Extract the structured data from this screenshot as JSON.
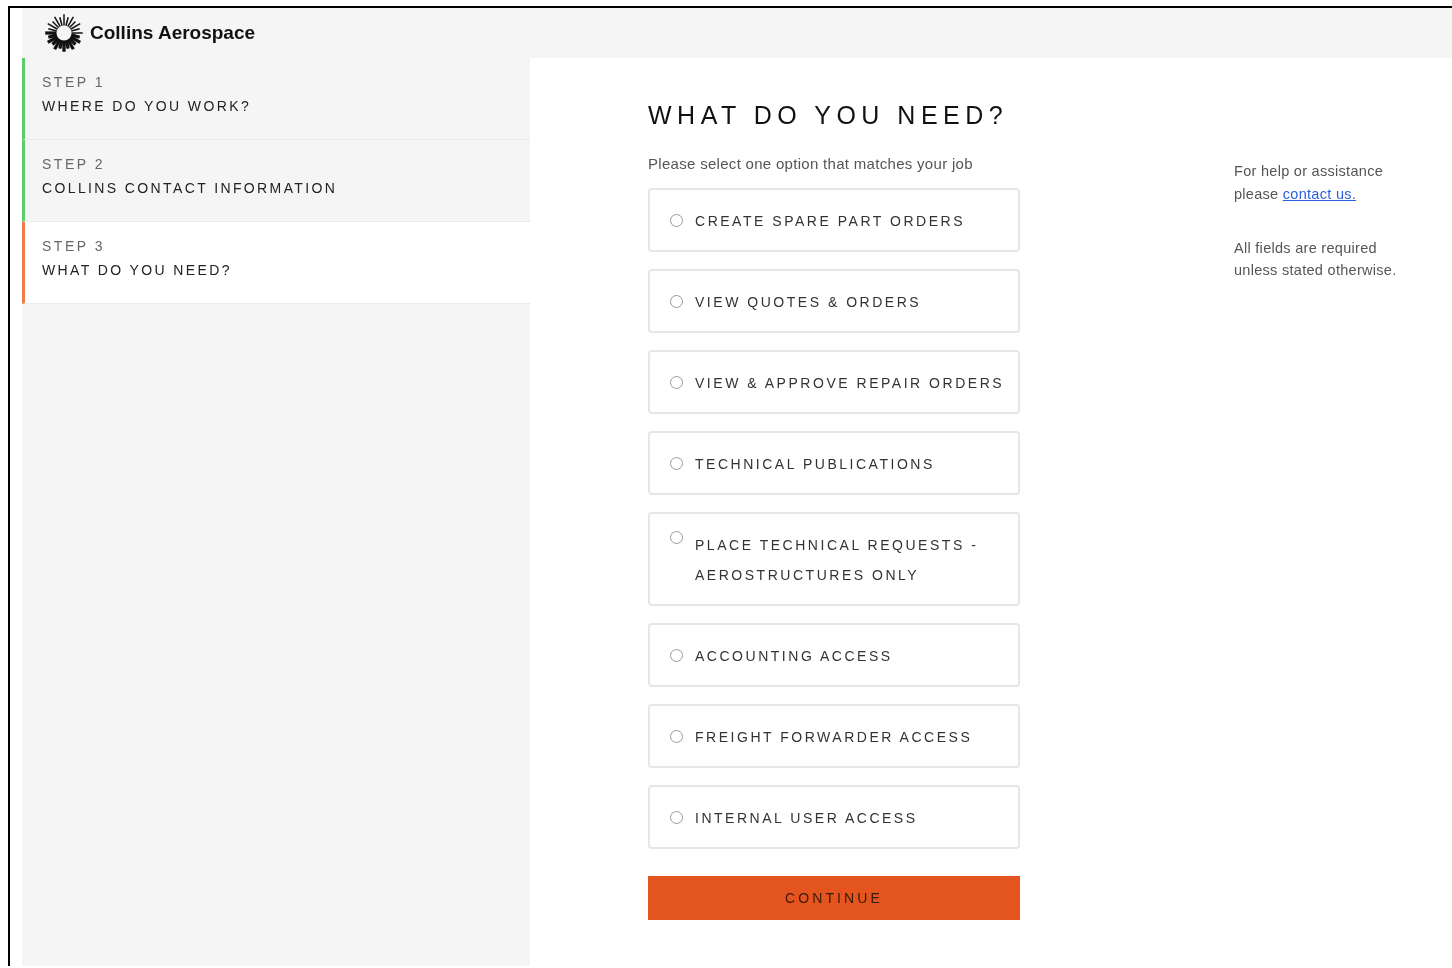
{
  "header": {
    "logo_text": "Collins Aerospace"
  },
  "steps": [
    {
      "number": "STEP 1",
      "title": "WHERE DO YOU WORK?",
      "completed": true,
      "current": false
    },
    {
      "number": "STEP 2",
      "title": "COLLINS CONTACT INFORMATION",
      "completed": true,
      "current": false
    },
    {
      "number": "STEP 3",
      "title": "WHAT DO YOU NEED?",
      "completed": false,
      "current": true
    }
  ],
  "main": {
    "title": "WHAT DO YOU NEED?",
    "instruction": "Please select one option that matches your job",
    "options": [
      {
        "label": "CREATE SPARE PART ORDERS",
        "selected": false
      },
      {
        "label": "VIEW QUOTES & ORDERS",
        "selected": false
      },
      {
        "label": "VIEW & APPROVE REPAIR ORDERS",
        "selected": false
      },
      {
        "label": "TECHNICAL PUBLICATIONS",
        "selected": false
      },
      {
        "label": "PLACE TECHNICAL REQUESTS - AEROSTRUCTURES ONLY",
        "selected": false
      },
      {
        "label": "ACCOUNTING ACCESS",
        "selected": false
      },
      {
        "label": "FREIGHT FORWARDER ACCESS",
        "selected": false
      },
      {
        "label": "INTERNAL USER ACCESS",
        "selected": false
      }
    ],
    "button": "CONTINUE"
  },
  "aside": {
    "help_text": "For help or assistance please",
    "help_link": "contact us.",
    "required_note": "All fields are required unless stated otherwise."
  }
}
